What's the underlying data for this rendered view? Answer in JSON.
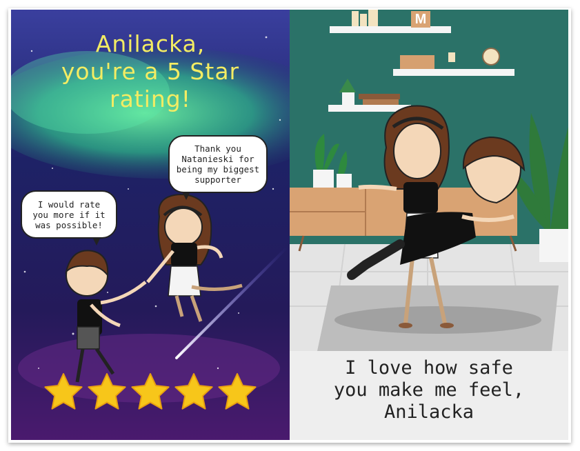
{
  "left_panel": {
    "title_line1": "Anilacka,",
    "title_line2": "you're a 5 Star",
    "title_line3": "rating!",
    "bubble_boy": "I would rate you more if it was possible!",
    "bubble_girl": "Thank you Natanieski for being my biggest supporter",
    "stars": 5,
    "colors": {
      "sky_top": "#2a1f6e",
      "aurora": "#2fd48a",
      "title": "#f3ec63",
      "star": "#f7c61a"
    }
  },
  "right_panel": {
    "shelf_letter": "M",
    "caption_line1": "I love how safe",
    "caption_line2": "you make me feel,",
    "caption_line3": "Anilacka",
    "colors": {
      "wall": "#2b7268",
      "floor": "#dcdcdc",
      "cabinet": "#d9a373"
    }
  }
}
